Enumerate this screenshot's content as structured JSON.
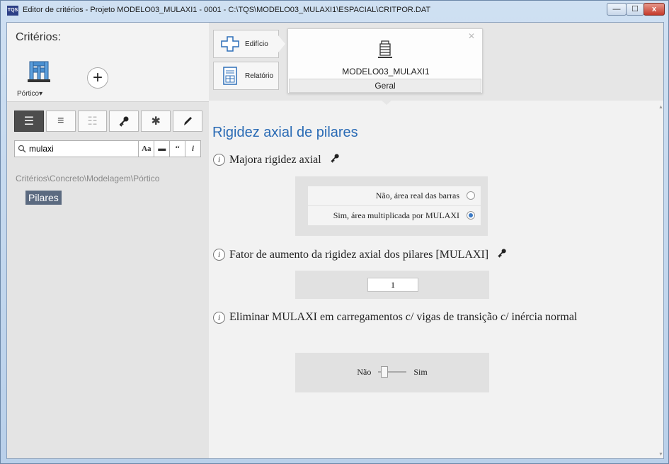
{
  "window": {
    "app_icon_text": "TQS",
    "title": "Editor de critérios - Projeto MODELO03_MULAXI1 - 0001 - C:\\TQS\\MODELO03_MULAXI1\\ESPACIAL\\CRITPOR.DAT",
    "min_glyph": "—",
    "max_glyph": "☐",
    "close_glyph": "x"
  },
  "left": {
    "criterios_label": "Critérios:",
    "portico_label": "Pórtico▾",
    "add_glyph": "+",
    "view_buttons": [
      "☰",
      "≡",
      "☷",
      "🔑",
      "✱",
      "✎"
    ],
    "search": {
      "value": "mulaxi",
      "placeholder": "",
      "btn_case": "Aa",
      "btn_word": "▬",
      "btn_quote": "‘‘",
      "btn_info": "i"
    },
    "breadcrumb": "Critérios\\Concreto\\Modelagem\\Pórtico",
    "selected_item": "Pilares"
  },
  "nav": {
    "tab_edificio": "Edifício",
    "tab_relatorio": "Relatório"
  },
  "card": {
    "close_glyph": "✕",
    "title": "MODELO03_MULAXI1",
    "subtitle": "Geral"
  },
  "content": {
    "section_title": "Rigidez axial de pilares",
    "info_glyph": "i",
    "q1": {
      "label": "Majora rigidez axial",
      "options": [
        "Não, área real das barras",
        "Sim, área multiplicada por MULAXI"
      ],
      "selected_index": 1
    },
    "q2": {
      "label": "Fator de aumento da rigidez axial dos pilares [MULAXI]",
      "value": "1"
    },
    "q3": {
      "label": "Eliminar MULAXI em carregamentos c/ vigas de transição c/ inércia normal",
      "toggle_off_label": "Não",
      "toggle_on_label": "Sim",
      "toggle_on": false
    }
  },
  "icons": {
    "key": "key-icon",
    "search": "search-icon",
    "building": "building-icon"
  },
  "colors": {
    "accent": "#2a6bb5",
    "selected_bg": "#5b6a80",
    "radio_on": "#3b79c4"
  }
}
